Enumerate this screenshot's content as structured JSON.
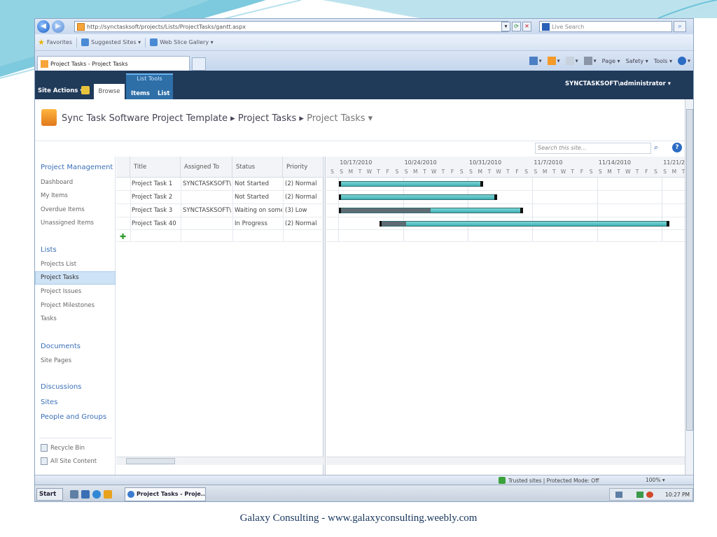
{
  "browser": {
    "url": "http://synctasksoft/projects/Lists/ProjectTasks/gantt.aspx",
    "live_search_placeholder": "Live Search",
    "favorites_label": "Favorites",
    "suggested_sites": "Suggested Sites ▾",
    "web_slice_gallery": "Web Slice Gallery ▾",
    "tab_title": "Project Tasks - Project Tasks",
    "cmd_page": "Page ▾",
    "cmd_safety": "Safety ▾",
    "cmd_tools": "Tools ▾"
  },
  "ribbon": {
    "site_actions": "Site Actions ▾",
    "browse": "Browse",
    "list_tools": "List Tools",
    "items": "Items",
    "list": "List",
    "user": "SYNCTASKSOFT\\administrator ▾"
  },
  "breadcrumb": {
    "site": "Sync Task Software Project Template",
    "sep": " ▸ ",
    "list": "Project Tasks",
    "view": "Project Tasks ▾"
  },
  "search": {
    "placeholder": "Search this site..."
  },
  "nav": {
    "project_management": "Project Management",
    "pm_items": [
      "Dashboard",
      "My Items",
      "Overdue Items",
      "Unassigned Items"
    ],
    "lists": "Lists",
    "list_items": [
      "Projects List",
      "Project Tasks",
      "Project Issues",
      "Project Milestones",
      "Tasks"
    ],
    "documents": "Documents",
    "site_pages": "Site Pages",
    "discussions": "Discussions",
    "sites": "Sites",
    "people_groups": "People and Groups",
    "recycle_bin": "Recycle Bin",
    "all_site_content": "All Site Content"
  },
  "grid": {
    "headers": [
      "Title",
      "Assigned To",
      "Status",
      "Priority"
    ],
    "rows": [
      {
        "title": "Project Task 1",
        "assigned": "SYNCTASKSOFT\\",
        "status": "Not Started",
        "priority": "(2) Normal",
        "start": 0.1,
        "end": 15.5,
        "progress": 0
      },
      {
        "title": "Project Task 2",
        "assigned": "",
        "status": "Not Started",
        "priority": "(2) Normal",
        "start": 0.1,
        "end": 17,
        "progress": 0
      },
      {
        "title": "Project Task 3",
        "assigned": "SYNCTASKSOFT\\",
        "status": "Waiting on some",
        "priority": "(3) Low",
        "start": 0.1,
        "end": 19.8,
        "progress": 0.5
      },
      {
        "title": "Project Task 40",
        "assigned": "",
        "status": "In Progress",
        "priority": "(2) Normal",
        "start": 4.5,
        "end": 35.7,
        "progress": 0.09
      }
    ]
  },
  "gantt": {
    "weeks": [
      "10/17/2010",
      "10/24/2010",
      "10/31/2010",
      "11/7/2010",
      "11/14/2010",
      "11/21/2"
    ],
    "day_letters": [
      "S",
      "M",
      "T",
      "W",
      "T",
      "F",
      "S"
    ]
  },
  "status_bar": {
    "zone": "Trusted sites | Protected Mode: Off",
    "zoom": "100% ▾"
  },
  "taskbar": {
    "start": "Start",
    "task": "Project Tasks - Proje...",
    "clock": "10:27 PM"
  },
  "caption": "Galaxy Consulting - www.galaxyconsulting.weebly.com",
  "colors": {
    "ribbon": "#203a5a",
    "bar": "#3fb0b4",
    "caption": "#17365d"
  }
}
